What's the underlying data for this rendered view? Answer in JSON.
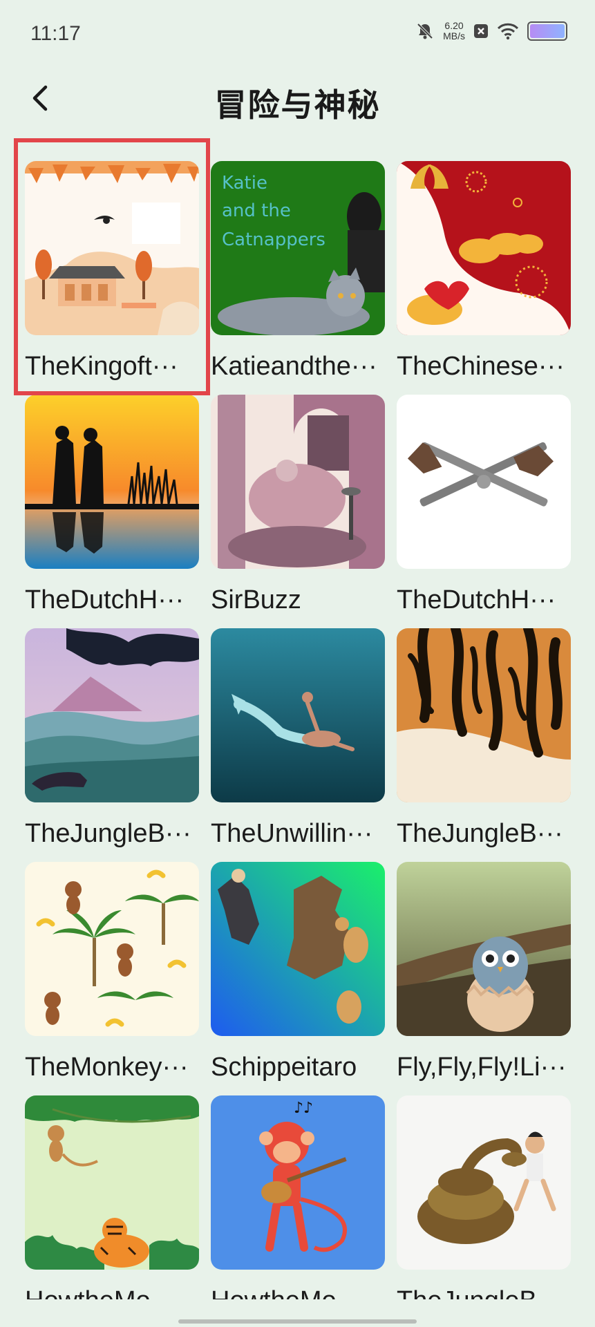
{
  "status": {
    "time": "11:17",
    "netspeed_value": "6.20",
    "netspeed_unit": "MB/s",
    "icons": [
      "mute-bell-icon",
      "close-box-icon",
      "wifi-icon",
      "battery-icon"
    ]
  },
  "header": {
    "title": "冒险与神秘",
    "back_icon": "chevron-left-icon"
  },
  "books": [
    {
      "title": "TheKingoft···",
      "cover": "autumn-pavilion-magpie",
      "selected": true
    },
    {
      "title": "Katieandthe···",
      "cover": "katie-catnappers",
      "cover_text": [
        "Katie",
        "and the",
        "Catnappers"
      ]
    },
    {
      "title": "TheChinese···",
      "cover": "red-ox-clouds"
    },
    {
      "title": "TheDutchH···",
      "cover": "sunset-silhouettes"
    },
    {
      "title": "SirBuzz",
      "cover": "vintage-engraving"
    },
    {
      "title": "TheDutchH···",
      "cover": "crossed-pistols"
    },
    {
      "title": "TheJungleB···",
      "cover": "jungle-panther"
    },
    {
      "title": "TheUnwillin···",
      "cover": "underwater-mermaid"
    },
    {
      "title": "TheJungleB···",
      "cover": "tiger-fur"
    },
    {
      "title": "TheMonkey···",
      "cover": "monkeys-palms-pattern"
    },
    {
      "title": "Schippeitaro",
      "cover": "samurai-cats"
    },
    {
      "title": "Fly,Fly,Fly!Li···",
      "cover": "owl-chick-egg"
    },
    {
      "title": "HowtheMo···",
      "cover": "jungle-monkey-tiger"
    },
    {
      "title": "HowtheMo···",
      "cover": "monkey-guitar"
    },
    {
      "title": "TheJungleB···",
      "cover": "snake-boy"
    }
  ],
  "colors": {
    "background": "#e8f2ea",
    "highlight": "#e2454a"
  }
}
